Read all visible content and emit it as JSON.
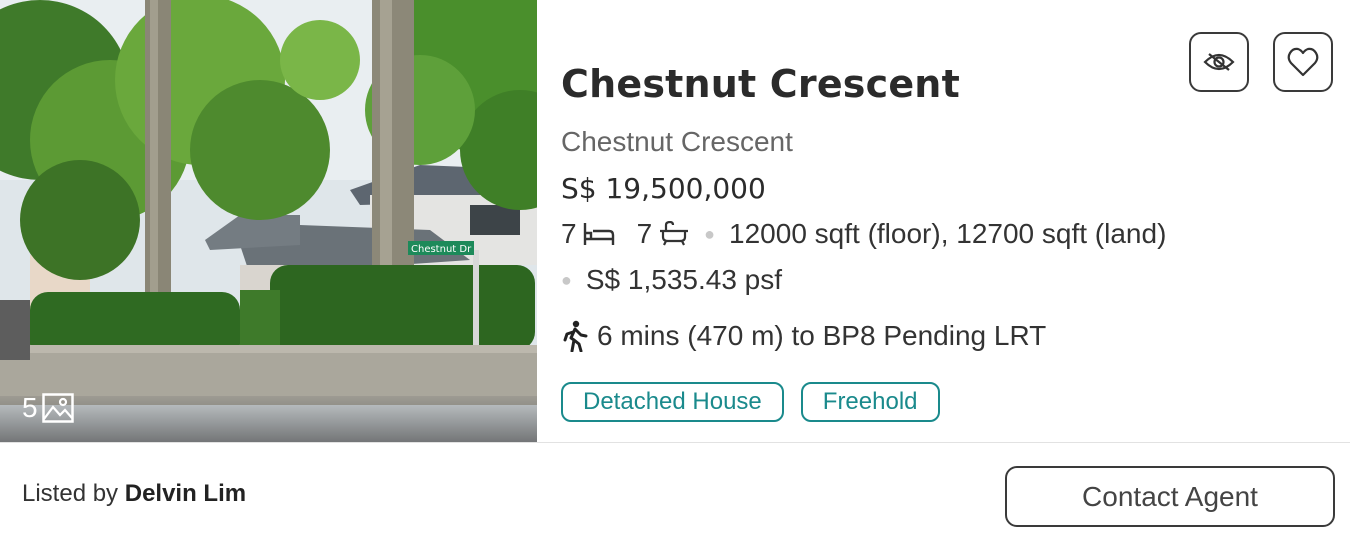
{
  "listing": {
    "photo_count": "5",
    "title": "Chestnut Crescent",
    "subtitle": "Chestnut Crescent",
    "price": "S$ 19,500,000",
    "bedrooms": "7",
    "bathrooms": "7",
    "area": "12000 sqft (floor), 12700 sqft (land)",
    "psf": "S$ 1,535.43 psf",
    "transit": "6 mins (470 m) to BP8 Pending LRT",
    "tags": [
      "Detached House",
      "Freehold"
    ],
    "street_sign": "Chestnut Dr"
  },
  "footer": {
    "listed_by_prefix": "Listed by",
    "agent_name": "Delvin Lim",
    "contact_label": "Contact Agent"
  },
  "icons": {
    "photos": "image-icon",
    "bed": "bed-icon",
    "bath": "bathtub-icon",
    "walk": "walking-person-icon",
    "hide": "eye-slash-icon",
    "favorite": "heart-icon"
  },
  "colors": {
    "tag_accent": "#1a8a8c",
    "border_dark": "#3a3a3a"
  }
}
